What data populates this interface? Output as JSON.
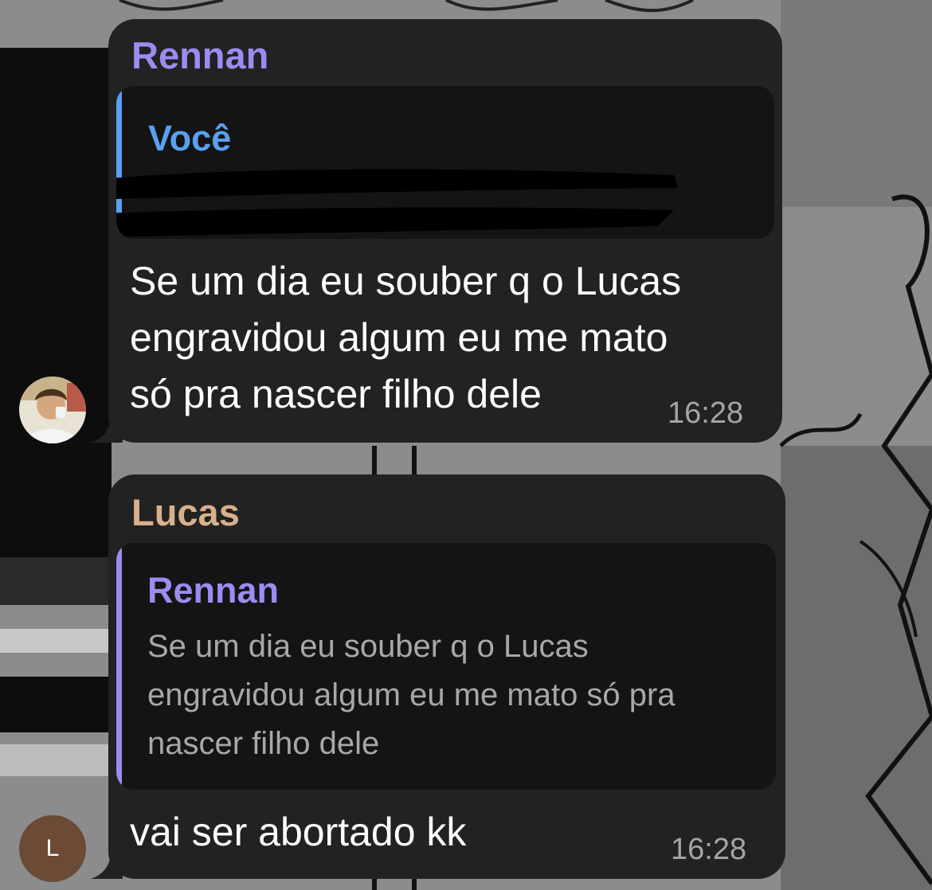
{
  "messages": [
    {
      "sender": "Rennan",
      "sender_color": "#9b8cf2",
      "reply": {
        "author": "Você",
        "author_color": "#5aa0f0",
        "bar_color": "#5aa0f0",
        "text": "",
        "redacted": true
      },
      "text": "Se um dia eu souber q o Lucas\nengravidou algum eu me mato\nsó pra nascer filho dele",
      "time": "16:28",
      "avatar": {
        "type": "photo",
        "icon": "user-photo-icon"
      }
    },
    {
      "sender": "Lucas",
      "sender_color": "#d9b08c",
      "reply": {
        "author": "Rennan",
        "author_color": "#9b8cf2",
        "bar_color": "#9b8cf2",
        "text": "Se um dia eu souber q o Lucas\nengravidou algum eu me mato só pra\nnascer filho dele"
      },
      "text": "vai ser abortado kk",
      "time": "16:28",
      "avatar": {
        "type": "initial",
        "initial": "L",
        "color": "#6b4a36"
      }
    }
  ]
}
